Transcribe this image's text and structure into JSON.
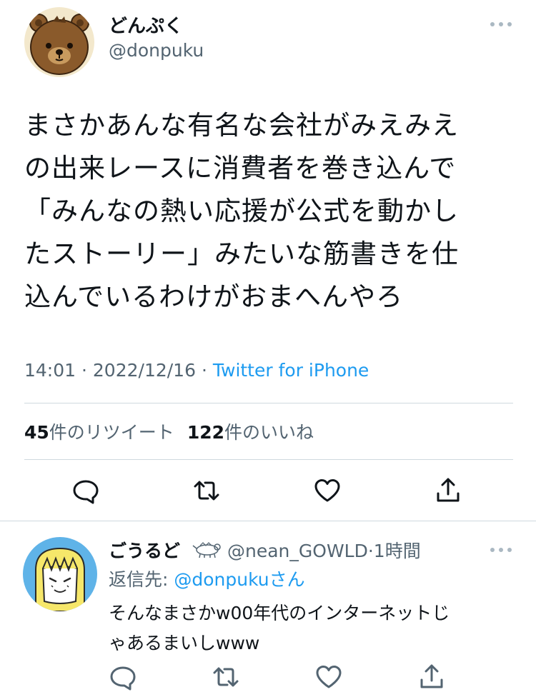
{
  "tweet": {
    "avatar_icon": "bear-avatar-icon",
    "display_name": "どんぷく",
    "handle": "@donpuku",
    "more_icon": "more-dots-icon",
    "text_lines": [
      "まさかあんな有名な会社がみえみえ",
      "の出来レースに消費者を巻き込んで",
      "「みんなの熱い応援が公式を動かし",
      "たストーリー」みたいな筋書きを仕",
      "込んでいるわけがおまへんやろ"
    ],
    "time": "14:01",
    "date": "2022/12/16",
    "source": "Twitter for iPhone",
    "retweet_count": "45",
    "retweet_label": "件のリツイート",
    "like_count": "122",
    "like_label": "件のいいね",
    "actions": [
      "reply-icon",
      "retweet-icon",
      "like-icon",
      "share-icon"
    ]
  },
  "reply": {
    "avatar_icon": "blonde-character-avatar-icon",
    "display_name": "ごうるど",
    "badge_icon": "animal-doodle-icon",
    "handle": "@nean_GOWLD",
    "time_ago": "1時間",
    "replying_prefix": "返信先: ",
    "replying_to": "@donpuku",
    "replying_suffix": "さん",
    "text_lines": [
      "そんなまさかw00年代のインターネットじ",
      "ゃあるまいしwww"
    ],
    "actions": [
      "reply-icon",
      "retweet-icon",
      "like-icon",
      "share-icon"
    ]
  },
  "colors": {
    "text": "#0f1419",
    "secondary": "#536471",
    "link": "#1d9bf0",
    "divider": "#cfd9de"
  }
}
